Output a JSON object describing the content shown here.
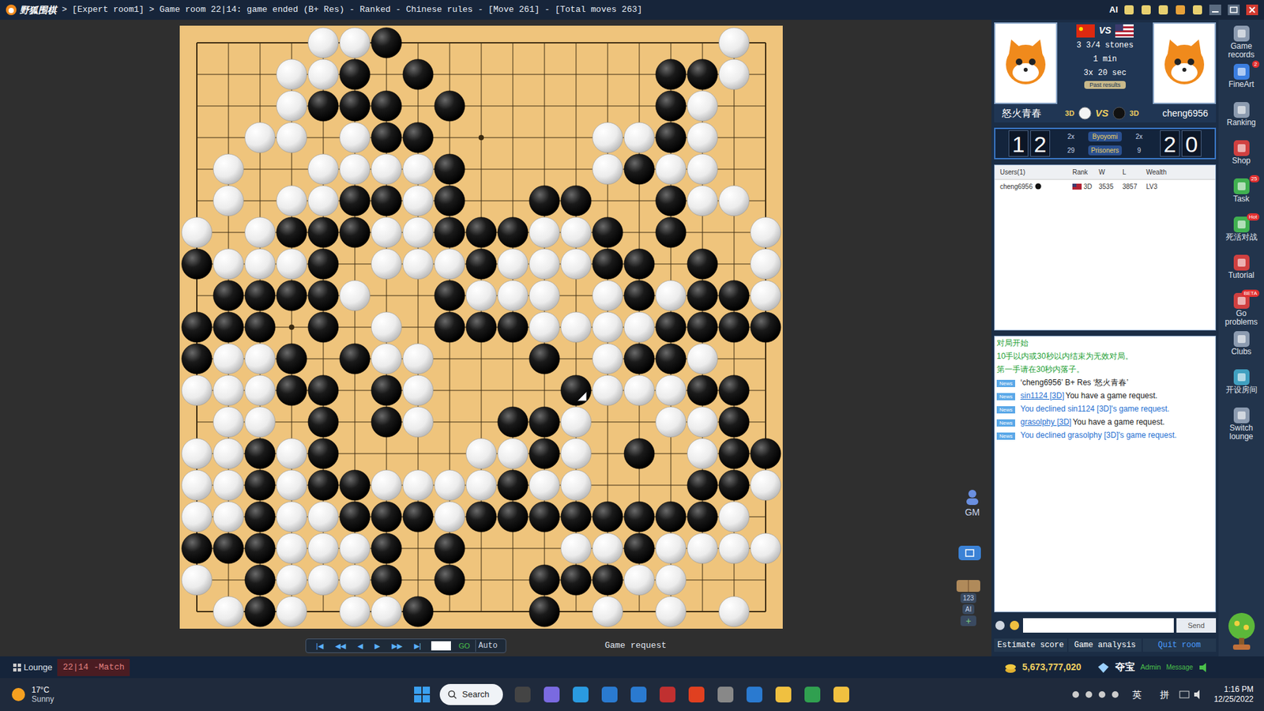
{
  "title_bar": {
    "logo": "野狐围棋",
    "breadcrumb": "> [Expert room1] > Game room 22|14: game ended (B+ Res) - Ranked - Chinese rules - [Move 261] - [Total moves 263]",
    "ai": "AI"
  },
  "board": {
    "rows": [
      "....WWB..........W.",
      "...WWB.B.......BBW.",
      "...WBBB.B......BW..",
      "..WW.WBB.....WWBW..",
      ".W..WWWWB....WBWW..",
      ".W.WWBBWB..BB..BWW.",
      "W.WBBBWWBBBWWB.B..W",
      "BWWWB.WWWBWWWBB.B.W",
      ".BBBBW..BWWW.WBWBBW",
      "BBB.B.W.BBBWWWWBBBB",
      "BWWB.BWW...B.WBBW..",
      "WWWBB.BW....BWWWBB.",
      ".WW.B.BW..BBW..WWB.",
      "WWBWB....WWBW.B.WBB",
      "WWBWBBWWWWBWW...BBW",
      "WWBWWBBBWBBBBBBBBW.",
      "BBBWWWB.B...WWBWWWW",
      "W.BWWWB.B..BBBWW...",
      ".WBW.WWB...B.W.W.W."
    ],
    "last_move": {
      "row": 11,
      "col": 12
    }
  },
  "controls": {
    "buttons": [
      "|◀",
      "◀◀",
      "◀",
      "▶",
      "▶▶",
      "▶|"
    ],
    "move_input": "",
    "go": "GO",
    "auto": "Auto",
    "game_request": "Game request"
  },
  "tools": {
    "gm": "GM",
    "counter": "123",
    "ai": "AI",
    "plus": "+"
  },
  "match": {
    "vs": "VS",
    "komi": "3 3/4 stones",
    "main_time": "1 min",
    "byoyomi": "3x 20 sec",
    "past": "Past results",
    "white": {
      "name": "怒火青春",
      "rank": "3D"
    },
    "black": {
      "name": "cheng6956",
      "rank": "3D"
    }
  },
  "score": {
    "white_digits": [
      "1",
      "2"
    ],
    "black_digits": [
      "2",
      "0"
    ],
    "byoyomi_label": "Byoyomi",
    "white_byoyomi": "2x",
    "black_byoyomi": "2x",
    "prisoners_label": "Prisoners",
    "white_prisoners": "29",
    "black_prisoners": "9"
  },
  "users": {
    "columns": [
      "Users(1)",
      "Rank",
      "W",
      "L",
      "Wealth"
    ],
    "rows": [
      [
        "cheng6956",
        "3D",
        "3535",
        "3857",
        "LV3"
      ]
    ]
  },
  "chat": {
    "messages": [
      {
        "tag": "",
        "link": "",
        "text": "对局开始",
        "color": "#22a033"
      },
      {
        "tag": "",
        "link": "",
        "text": "10手以内或30秒以内结束为无效对局。",
        "color": "#22a033"
      },
      {
        "tag": "",
        "link": "",
        "text": "第一手请在30秒内落子。",
        "color": "#22a033"
      },
      {
        "tag": "News",
        "link": "",
        "text": "‘cheng6956’ B+ Res ‘怒火青春’",
        "color": "#222222"
      },
      {
        "tag": "News",
        "link": "sin1124 [3D]",
        "text": "You have a game request.",
        "color": "#222222"
      },
      {
        "tag": "News",
        "link": "",
        "text": "You declined sin1124 [3D]'s game request.",
        "color": "#1f6fd1"
      },
      {
        "tag": "News",
        "link": "grasolphy [3D]",
        "text": "You have a game request.",
        "color": "#222222"
      },
      {
        "tag": "News",
        "link": "",
        "text": "You declined grasolphy [3D]'s game request.",
        "color": "#1f6fd1"
      }
    ],
    "input": "",
    "send": "Send"
  },
  "actions": [
    "Estimate score",
    "Game analysis",
    "Quit room"
  ],
  "sidebar": [
    {
      "label": "Game records",
      "badge": ""
    },
    {
      "label": "FineArt",
      "badge": "2"
    },
    {
      "label": "Ranking",
      "badge": ""
    },
    {
      "label": "Shop",
      "badge": ""
    },
    {
      "label": "Task",
      "badge": "25"
    },
    {
      "label": "死活对战",
      "badge": "Hot"
    },
    {
      "label": "Tutorial",
      "badge": ""
    },
    {
      "label": "Go problems",
      "badge": "BETA"
    },
    {
      "label": "Clubs",
      "badge": ""
    },
    {
      "label": "开设房间",
      "badge": ""
    },
    {
      "label": "Switch lounge",
      "badge": ""
    }
  ],
  "status": {
    "tabs": [
      {
        "label": "Lounge",
        "selected": false
      },
      {
        "label": "22|14 -Match",
        "selected": true
      }
    ],
    "coins": "5,673,777,020",
    "treasure": "夺宝",
    "admin": "Admin",
    "message": "Message"
  },
  "taskbar": {
    "temp": "17°C",
    "weather": "Sunny",
    "search": "Search",
    "ime1": "英",
    "ime2": "拼",
    "time": "1:16 PM",
    "date": "12/25/2022"
  }
}
